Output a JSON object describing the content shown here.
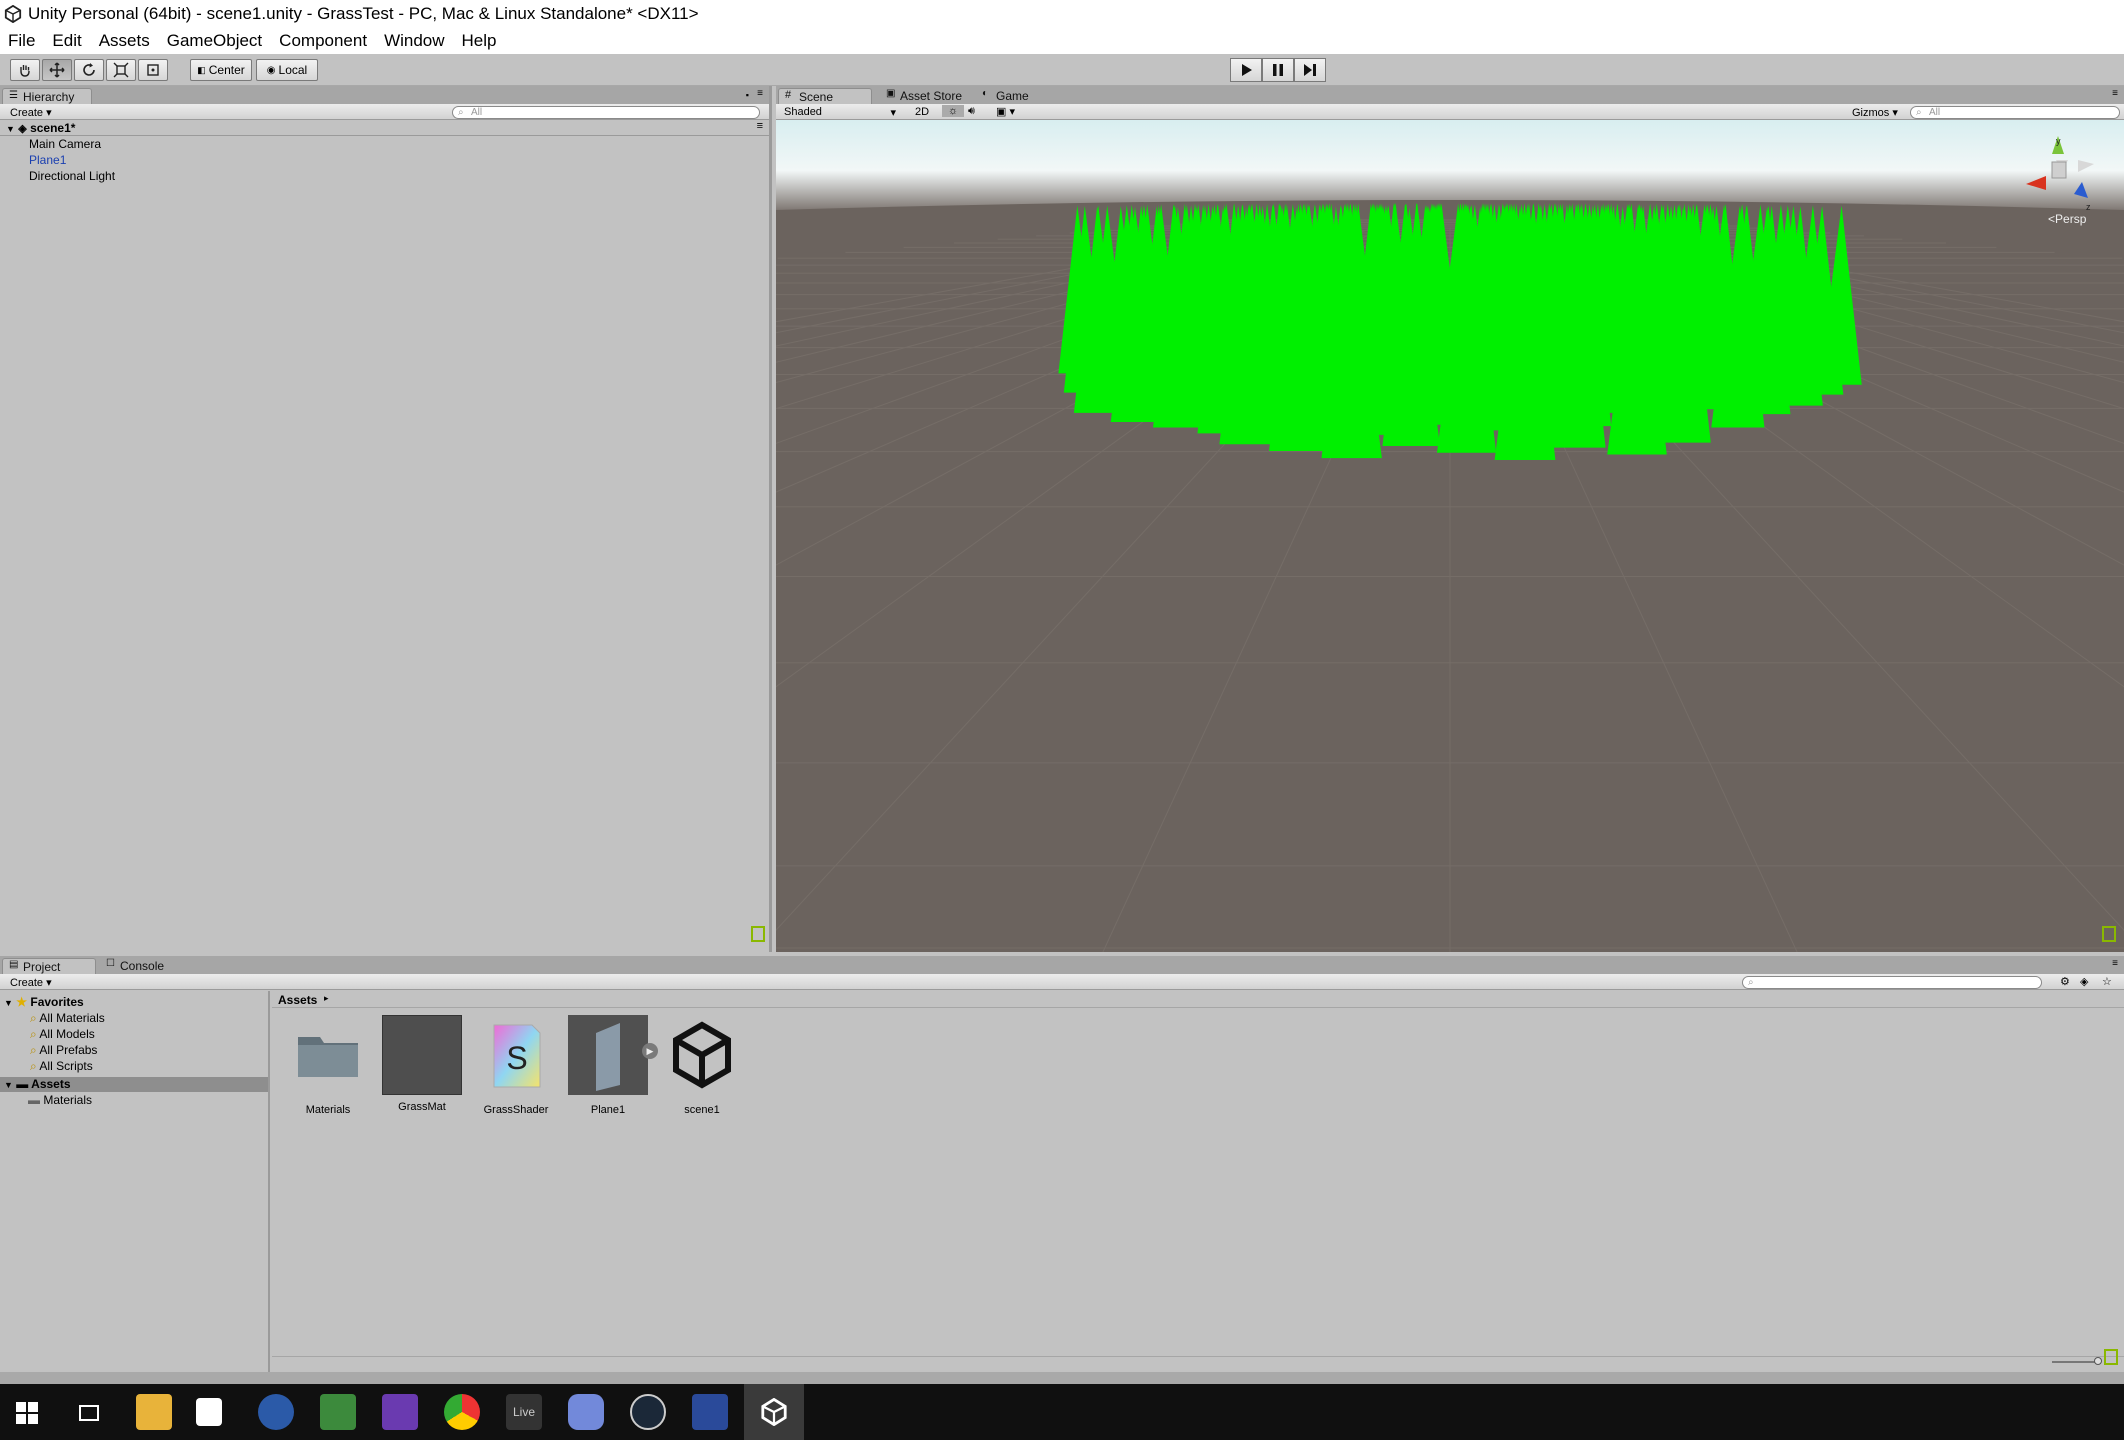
{
  "titlebar": {
    "title": "Unity Personal (64bit) - scene1.unity - GrassTest - PC, Mac & Linux Standalone* <DX11>"
  },
  "menubar": {
    "items": [
      "File",
      "Edit",
      "Assets",
      "GameObject",
      "Component",
      "Window",
      "Help"
    ]
  },
  "toolbar": {
    "pivot_label": "Center",
    "space_label": "Local",
    "tools": [
      "hand-tool",
      "move-tool",
      "rotate-tool",
      "scale-tool",
      "rect-tool"
    ]
  },
  "hierarchy": {
    "tab": "Hierarchy",
    "create": "Create",
    "search_placeholder": "All",
    "scene_name": "scene1*",
    "items": [
      "Main Camera",
      "Plane1",
      "Directional Light"
    ]
  },
  "scene_tabs": {
    "scene": "Scene",
    "asset_store": "Asset Store",
    "game": "Game"
  },
  "scene_toolbar": {
    "shading": "Shaded",
    "mode_2d": "2D",
    "gizmos": "Gizmos",
    "search_placeholder": "All",
    "persp_label": "Persp",
    "axis_labels": {
      "y": "y",
      "z": "z"
    }
  },
  "project": {
    "tab": "Project",
    "console_tab": "Console",
    "create": "Create",
    "favorites_header": "Favorites",
    "favorites": [
      "All Materials",
      "All Models",
      "All Prefabs",
      "All Scripts"
    ],
    "assets_header": "Assets",
    "asset_folders": [
      "Materials"
    ],
    "breadcrumb": "Assets",
    "assets": [
      {
        "name": "Materials",
        "kind": "folder"
      },
      {
        "name": "GrassMat",
        "kind": "material"
      },
      {
        "name": "GrassShader",
        "kind": "shader"
      },
      {
        "name": "Plane1",
        "kind": "mesh"
      },
      {
        "name": "scene1",
        "kind": "scene"
      }
    ]
  },
  "colors": {
    "grass": "#00f000",
    "ground": "#6b635e",
    "selected": "#1a3fb0"
  },
  "taskbar": {
    "live_label": "Live"
  }
}
